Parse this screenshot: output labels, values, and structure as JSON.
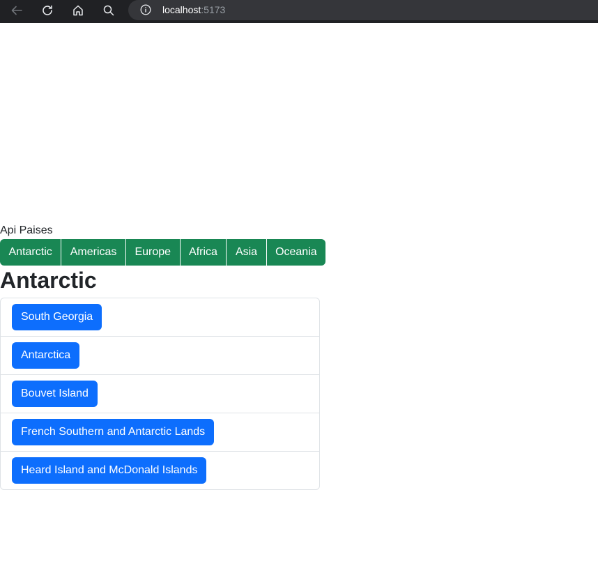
{
  "browser": {
    "url_host": "localhost",
    "url_port": ":5173"
  },
  "app": {
    "title": "Api Paises"
  },
  "regions": [
    {
      "label": "Antarctic"
    },
    {
      "label": "Americas"
    },
    {
      "label": "Europe"
    },
    {
      "label": "Africa"
    },
    {
      "label": "Asia"
    },
    {
      "label": "Oceania"
    }
  ],
  "selected_region": "Antarctic",
  "countries": [
    {
      "name": "South Georgia"
    },
    {
      "name": "Antarctica"
    },
    {
      "name": "Bouvet Island"
    },
    {
      "name": "French Southern and Antarctic Lands"
    },
    {
      "name": "Heard Island and McDonald Islands"
    }
  ],
  "colors": {
    "region_button": "#198754",
    "country_button": "#0d6efd",
    "browser_chrome": "#202124"
  }
}
